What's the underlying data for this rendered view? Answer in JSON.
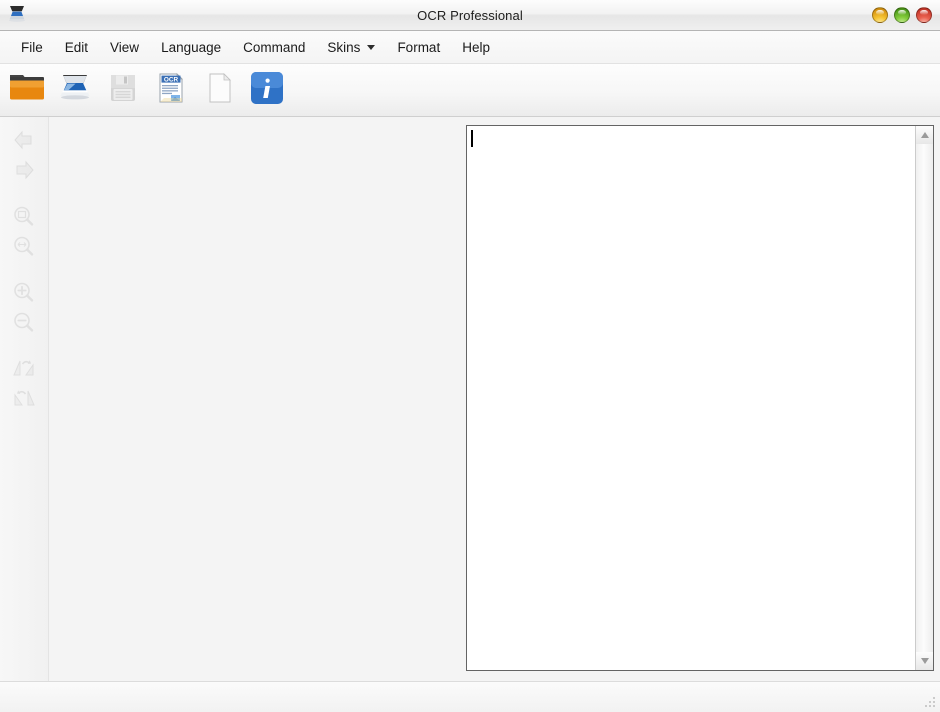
{
  "window": {
    "title": "OCR Professional",
    "title_icon": "scanner-icon",
    "buttons": {
      "minimize": "minimize-button",
      "maximize": "maximize-button",
      "close": "close-button"
    }
  },
  "menubar": {
    "items": [
      {
        "label": "File",
        "has_dropdown_arrow": false
      },
      {
        "label": "Edit",
        "has_dropdown_arrow": false
      },
      {
        "label": "View",
        "has_dropdown_arrow": false
      },
      {
        "label": "Language",
        "has_dropdown_arrow": false
      },
      {
        "label": "Command",
        "has_dropdown_arrow": false
      },
      {
        "label": "Skins",
        "has_dropdown_arrow": true
      },
      {
        "label": "Format",
        "has_dropdown_arrow": false
      },
      {
        "label": "Help",
        "has_dropdown_arrow": false
      }
    ]
  },
  "toolbar": {
    "items": [
      {
        "icon": "open-folder-icon",
        "enabled": true
      },
      {
        "icon": "scanner-icon",
        "enabled": true
      },
      {
        "icon": "save-floppy-icon",
        "enabled": false
      },
      {
        "icon": "ocr-document-icon",
        "enabled": true
      },
      {
        "icon": "new-page-icon",
        "enabled": true
      },
      {
        "icon": "info-icon",
        "enabled": true
      }
    ]
  },
  "sidebar": {
    "items": [
      {
        "icon": "previous-page-arrow-icon",
        "enabled": false,
        "group": 1
      },
      {
        "icon": "next-page-arrow-icon",
        "enabled": false,
        "group": 1
      },
      {
        "icon": "fit-page-icon",
        "enabled": false,
        "group": 2
      },
      {
        "icon": "fit-width-icon",
        "enabled": false,
        "group": 2
      },
      {
        "icon": "zoom-in-icon",
        "enabled": false,
        "group": 3
      },
      {
        "icon": "zoom-out-icon",
        "enabled": false,
        "group": 3
      },
      {
        "icon": "rotate-left-icon",
        "enabled": false,
        "group": 4
      },
      {
        "icon": "rotate-right-icon",
        "enabled": false,
        "group": 4
      }
    ]
  },
  "image_pane": {
    "content": ""
  },
  "text_pane": {
    "value": "",
    "placeholder": "",
    "caret_visible": true
  },
  "scrollbar": {
    "up_arrow": "scroll-up-arrow-icon",
    "down_arrow": "scroll-down-arrow-icon"
  },
  "statusbar": {
    "text": ""
  },
  "colors": {
    "folder_orange": "#e8870f",
    "folder_flap": "#444444",
    "scanner_blue": "#1f63b5",
    "info_blue": "#2f72c6",
    "ocr_band": "#3a6fb5",
    "minimize": "#f5c333",
    "maximize": "#84cc3c",
    "close": "#e9604f",
    "pane_bg": "#f4f4f4",
    "text_bg": "#ffffff"
  }
}
